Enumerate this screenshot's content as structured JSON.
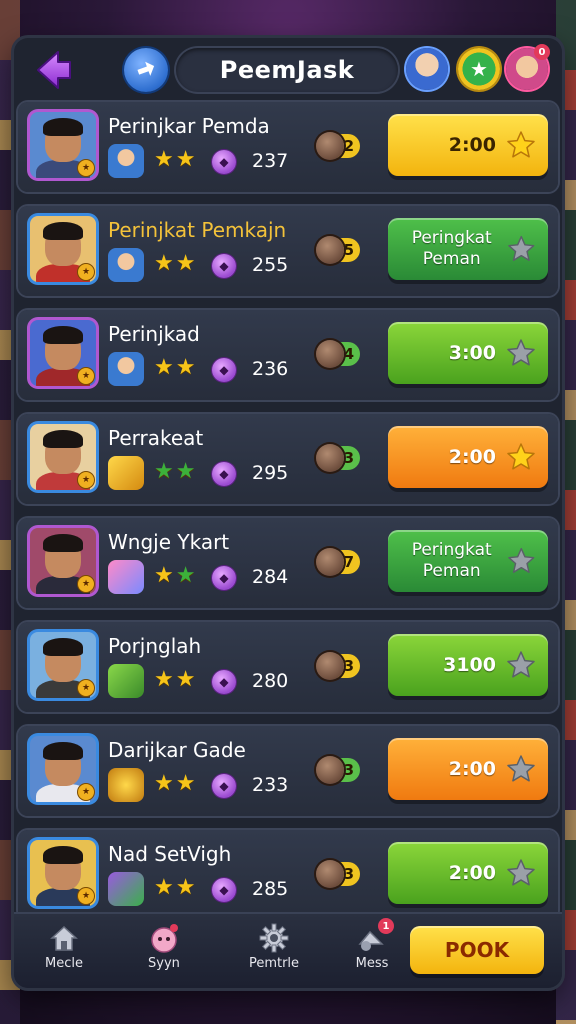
{
  "header": {
    "title": "PeemJask",
    "notification_count": "0"
  },
  "rows": [
    {
      "name": "Perinjkar Pemda",
      "score": "237",
      "badge": "2",
      "button_text": "2:00",
      "button_color": "yellow",
      "button_star": "gold",
      "stars": [
        "gold",
        "gold"
      ],
      "badge_color": "#f0c420",
      "name_color": "white",
      "item": "character",
      "frame": "#b058d0"
    },
    {
      "name": "Perinjkat Pemkajn",
      "score": "255",
      "badge": "5",
      "button_text": "Peringkat Peman",
      "button_color": "greentext",
      "button_star": "grey",
      "stars": [
        "gold",
        "gold"
      ],
      "badge_color": "#f0c420",
      "name_color": "gold",
      "item": "character",
      "frame": "#3a8ae0"
    },
    {
      "name": "Perinjkad",
      "score": "236",
      "badge": "4",
      "button_text": "3:00",
      "button_color": "green",
      "button_star": "grey",
      "stars": [
        "gold",
        "gold"
      ],
      "badge_color": "#5ac04a",
      "name_color": "white",
      "item": "character",
      "frame": "#b058d0"
    },
    {
      "name": "Perrakeat",
      "score": "295",
      "badge": "3",
      "button_text": "2:00",
      "button_color": "orange",
      "button_star": "gold",
      "stars": [
        "green",
        "green"
      ],
      "badge_color": "#5ac04a",
      "name_color": "white",
      "item": "gold-bar",
      "frame": "#3a8ae0"
    },
    {
      "name": "Wngje Ykart",
      "score": "284",
      "badge": "7",
      "button_text": "Peringkat Peman",
      "button_color": "greentext",
      "button_star": "grey",
      "stars": [
        "gold",
        "green"
      ],
      "badge_color": "#f0c420",
      "name_color": "white",
      "item": "candy",
      "frame": "#b058d0"
    },
    {
      "name": "Porjnglah",
      "score": "280",
      "badge": "3",
      "button_text": "3100",
      "button_color": "green",
      "button_star": "grey",
      "stars": [
        "gold",
        "gold"
      ],
      "badge_color": "#f0c420",
      "name_color": "white",
      "item": "cash",
      "frame": "#3a8ae0"
    },
    {
      "name": "Darijkar Gade",
      "score": "233",
      "badge": "3",
      "button_text": "2:00",
      "button_color": "orange",
      "button_star": "grey",
      "stars": [
        "gold",
        "gold"
      ],
      "badge_color": "#5ac04a",
      "name_color": "white",
      "item": "gold-pile",
      "frame": "#3a8ae0"
    },
    {
      "name": "Nad SetVigh",
      "score": "285",
      "badge": "3",
      "button_text": "2:00",
      "button_color": "green",
      "button_star": "grey",
      "stars": [
        "gold",
        "gold"
      ],
      "badge_color": "#f0c420",
      "name_color": "white",
      "item": "gem-cluster",
      "frame": "#3a8ae0"
    }
  ],
  "bottom_nav": {
    "items": [
      {
        "label": "Mecle",
        "icon": "home-icon"
      },
      {
        "label": "Syyn",
        "icon": "character-icon"
      },
      {
        "label": "Pemtrle",
        "icon": "gear-icon"
      },
      {
        "label": "Mess",
        "icon": "message-icon",
        "badge": "1"
      }
    ],
    "action_label": "POOK"
  },
  "colors": {
    "accent_yellow": "#f3b40e",
    "accent_green": "#4aa21e",
    "accent_orange": "#f07a10",
    "panel": "#1f2430"
  }
}
